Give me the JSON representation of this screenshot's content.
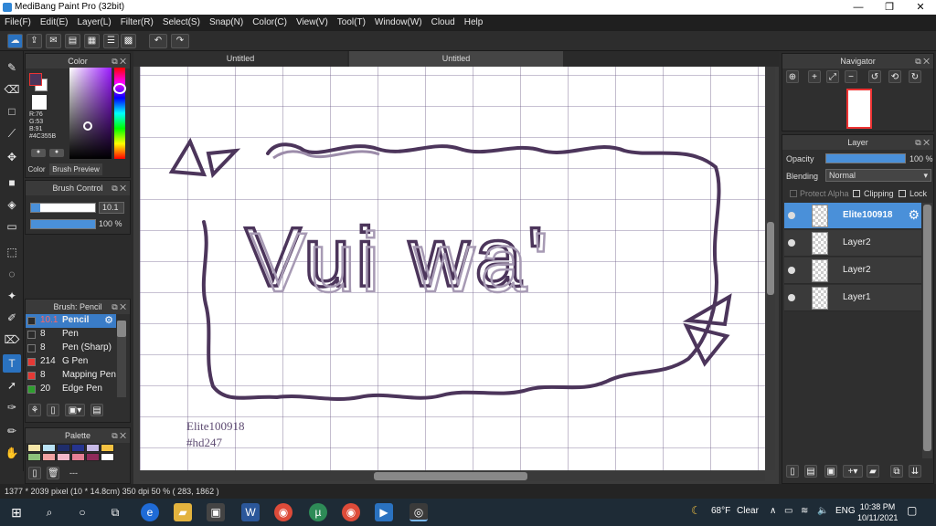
{
  "window": {
    "title": "MediBang Paint Pro (32bit)",
    "minimize": "—",
    "maximize": "❐",
    "close": "✕"
  },
  "menu": [
    "File(F)",
    "Edit(E)",
    "Layer(L)",
    "Filter(R)",
    "Select(S)",
    "Snap(N)",
    "Color(C)",
    "View(V)",
    "Tool(T)",
    "Window(W)",
    "Cloud",
    "Help"
  ],
  "tabs": [
    "Untitled",
    "Untitled"
  ],
  "color_panel": {
    "title": "Color",
    "r": "R:76",
    "g": "G:53",
    "b": "B:91",
    "hex": "#4C355B",
    "foreground": "#4c355b",
    "background": "#ffffff",
    "tab_color": "Color",
    "tab_preview": "Brush Preview"
  },
  "brush_control": {
    "title": "Brush Control",
    "size": "10.1",
    "opacity": "100 %"
  },
  "brush_panel": {
    "title": "Brush: Pencil",
    "items": [
      {
        "size": "10.1",
        "name": "Pencil",
        "color": "#ffffff",
        "selected": true
      },
      {
        "size": "8",
        "name": "Pen",
        "color": "#2b2b2b"
      },
      {
        "size": "8",
        "name": "Pen (Sharp)",
        "color": "#2b2b2b"
      },
      {
        "size": "214",
        "name": "G Pen",
        "color": "#e53935"
      },
      {
        "size": "8",
        "name": "Mapping Pen",
        "color": "#e53935"
      },
      {
        "size": "20",
        "name": "Edge Pen",
        "color": "#2e9e2e"
      }
    ]
  },
  "palette": {
    "title": "Palette",
    "swatches": [
      "#f5e6a8",
      "#b9e2f5",
      "#1f2d6b",
      "#26348f",
      "#c7b9e6",
      "#f5c242",
      "#8ec27a",
      "#f0a3a3",
      "#f3b8c8",
      "#e47f94",
      "#8f2a5a",
      "#ffffff"
    ],
    "more": "---"
  },
  "navigator": {
    "title": "Navigator"
  },
  "layer_panel": {
    "title": "Layer",
    "opacity_label": "Opacity",
    "opacity_value": "100 %",
    "blending_label": "Blending",
    "blending_value": "Normal",
    "protect_alpha": "Protect Alpha",
    "clipping": "Clipping",
    "lock": "Lock",
    "layers": [
      "Elite100918",
      "Layer2",
      "Layer2",
      "Layer1"
    ]
  },
  "canvas": {
    "drawing_text": "Vui wa'",
    "credit_line1": "Elite100918",
    "credit_line2": "#hd247",
    "stroke_color": "#4c355b"
  },
  "status": {
    "text": "1377 * 2039 pixel  (10 * 14.8cm)  350 dpi  50 %  ( 283, 1862 )"
  },
  "taskbar": {
    "weather_temp": "68°F",
    "weather_desc": "Clear",
    "lang": "ENG",
    "time": "10:38 PM",
    "date": "10/11/2021"
  }
}
